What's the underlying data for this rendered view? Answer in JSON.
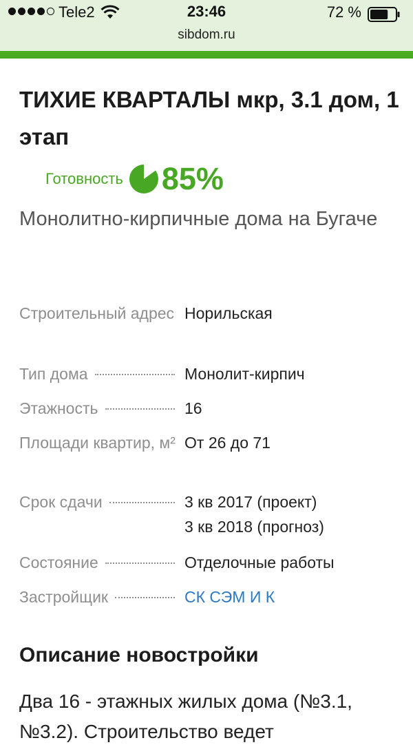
{
  "status_bar": {
    "carrier": "Tele2",
    "time": "23:46",
    "battery": "72 %",
    "battery_level": 0.72,
    "signal_bars_filled": 4,
    "signal_bars_total": 5
  },
  "browser": {
    "url": "sibdom.ru"
  },
  "listing": {
    "title": "ТИХИЕ КВАРТАЛЫ мкр, 3.1 дом, 1 этап",
    "readiness_label": "Готовность",
    "readiness_value": "85%",
    "readiness_fraction": 0.85,
    "subtitle": "Монолитно-кирпичные дома на Бугаче"
  },
  "properties": {
    "address": {
      "label": "Строительный адрес",
      "value": "Норильская"
    },
    "house_type": {
      "label": "Тип дома",
      "value": "Монолит-кирпич"
    },
    "floors": {
      "label": "Этажность",
      "value": "16"
    },
    "area": {
      "label": "Площади квартир, м²",
      "value": "От 26 до 71"
    },
    "deadline": {
      "label": "Срок сдачи",
      "value_line1": "3 кв 2017 (проект)",
      "value_line2": "3 кв 2018 (прогноз)"
    },
    "state": {
      "label": "Состояние",
      "value": "Отделочные работы"
    },
    "developer": {
      "label": "Застройщик",
      "value": "СК СЭМ И К"
    }
  },
  "description": {
    "title": "Описание новостройки",
    "text": "Два 16 - этажных жилых дома (№3.1, №3.2). Строительство ведет"
  },
  "colors": {
    "accent_green": "#48a823",
    "link_blue": "#2d7ac4",
    "header_bg": "#e4f1dd"
  }
}
